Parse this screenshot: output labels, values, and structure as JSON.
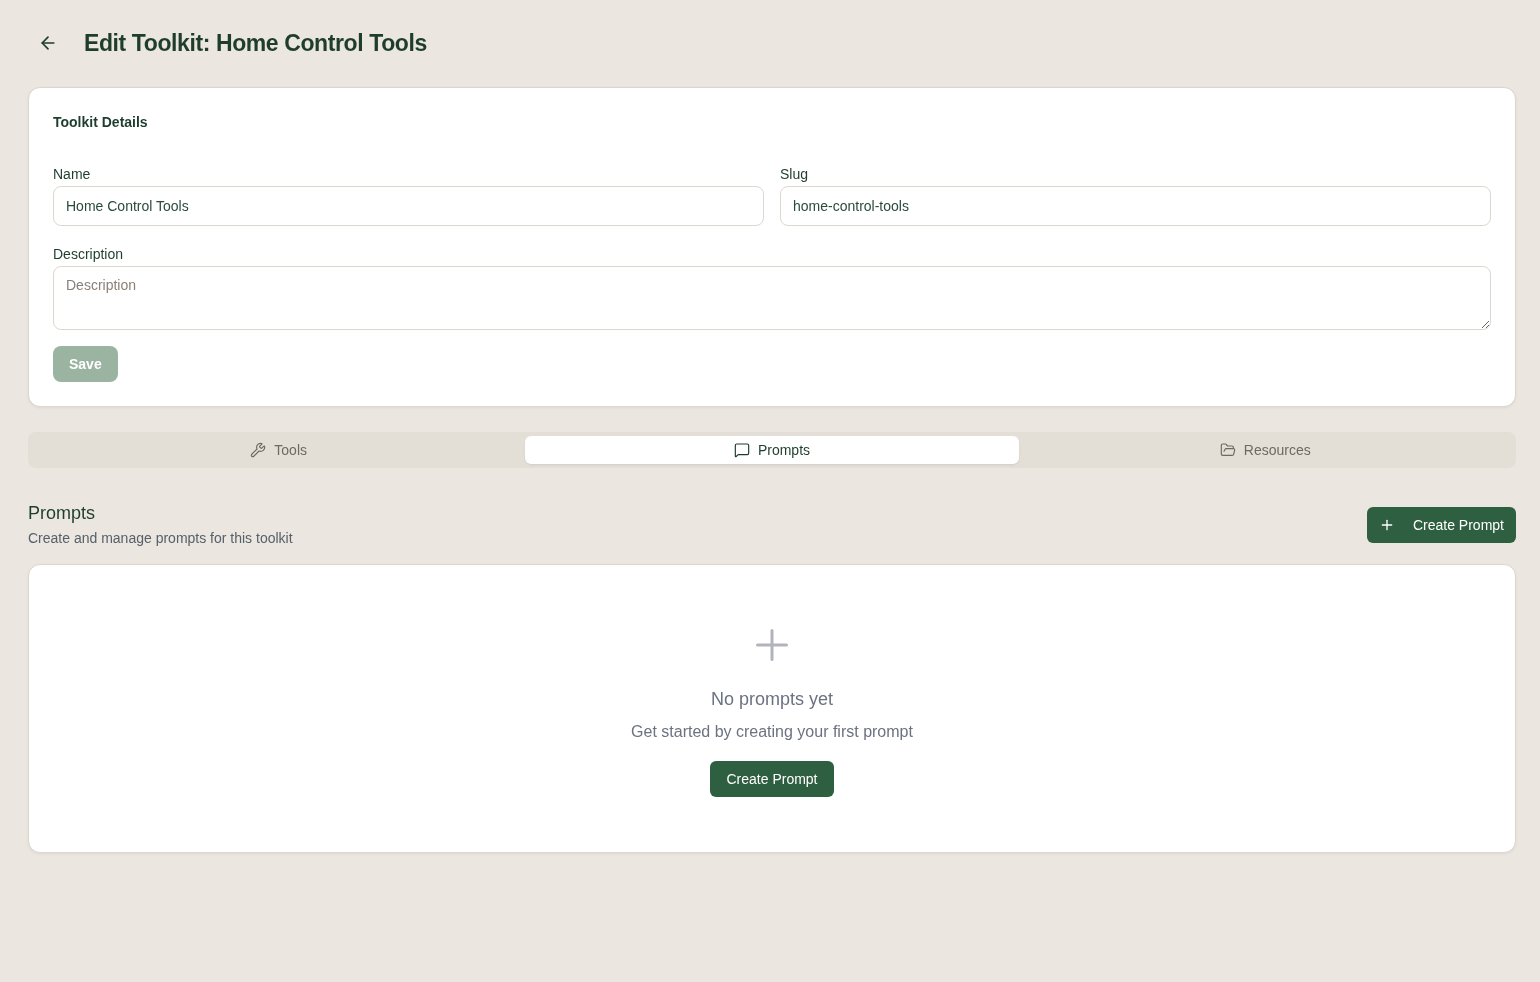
{
  "header": {
    "title": "Edit Toolkit: Home Control Tools"
  },
  "details_card": {
    "title": "Toolkit Details",
    "fields": [
      {
        "kind": "input",
        "label": "Name",
        "value": "Home Control Tools"
      },
      {
        "kind": "input",
        "label": "Slug",
        "value": "home-control-tools"
      },
      {
        "kind": "textarea",
        "label": "Description",
        "placeholder": "Description"
      }
    ],
    "save_button": {
      "label": "Save",
      "disabled": true
    }
  },
  "tabs": [
    {
      "label": "Tools",
      "selected": false
    },
    {
      "label": "Prompts",
      "selected": true
    },
    {
      "label": "Resources",
      "selected": false
    }
  ],
  "prompts_section": {
    "title": "Prompts",
    "subtitle": "Create and manage prompts for this toolkit",
    "create_button": "Create Prompt",
    "empty_state": {
      "title": "No prompts yet",
      "message": "Get started by creating your first prompt",
      "button": "Create Prompt"
    }
  }
}
